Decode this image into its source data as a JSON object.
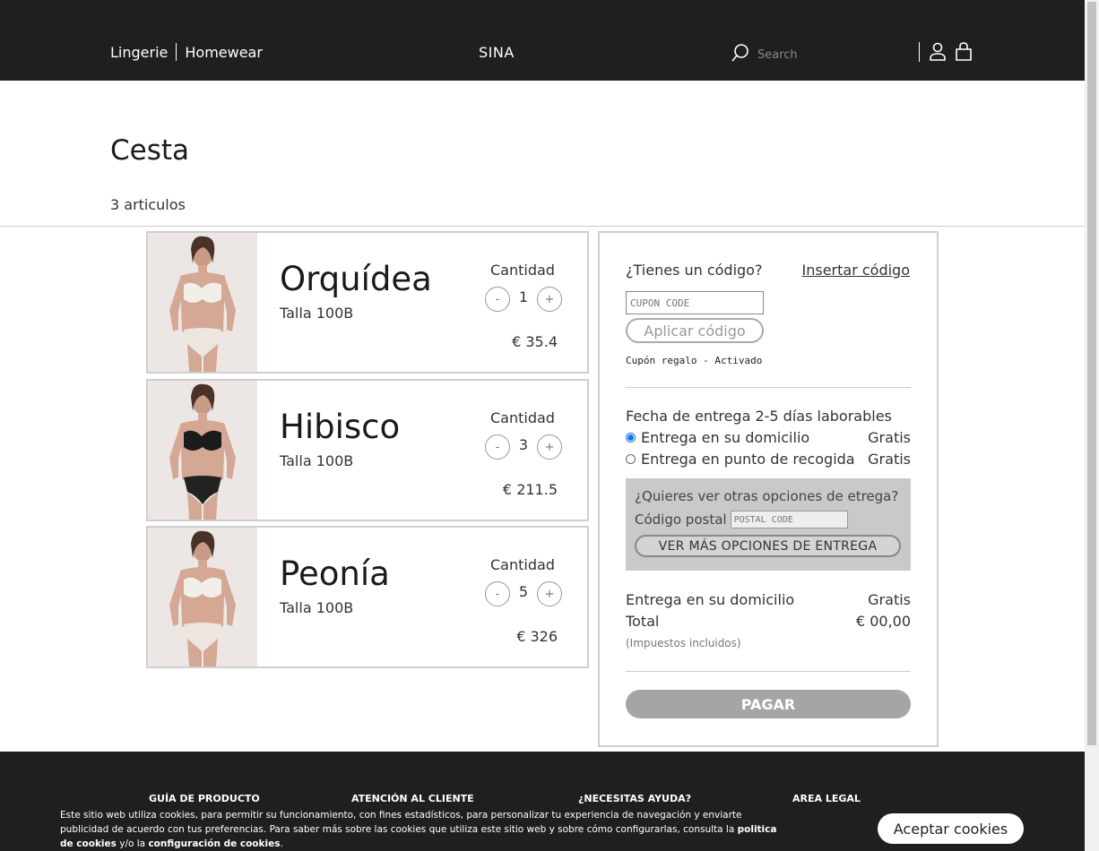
{
  "header": {
    "nav_lingerie": "Lingerie",
    "nav_homewear": "Homewear",
    "brand": "SINA",
    "search_placeholder": "Search"
  },
  "page": {
    "title": "Cesta",
    "item_count": "3 articulos"
  },
  "cart": {
    "items": [
      {
        "name": "Orquídea",
        "size": "Talla 100B",
        "qty_label": "Cantidad",
        "qty": "1",
        "price": "€ 35.4",
        "minus": "-",
        "plus": "+",
        "bra_color": "#f2efe9",
        "brief_color": "#ece6de"
      },
      {
        "name": "Hibisco",
        "size": "Talla 100B",
        "qty_label": "Cantidad",
        "qty": "3",
        "price": "€ 211.5",
        "minus": "-",
        "plus": "+",
        "bra_color": "#1b1b1b",
        "brief_color": "#222222"
      },
      {
        "name": "Peonía",
        "size": "Talla 100B",
        "qty_label": "Cantidad",
        "qty": "5",
        "price": "€ 326",
        "minus": "-",
        "plus": "+",
        "bra_color": "#f2efe9",
        "brief_color": "#ece6de"
      }
    ]
  },
  "summary": {
    "coupon_question": "¿Tienes un código?",
    "coupon_link": "Insertar código",
    "coupon_placeholder": "CUPON CODE",
    "apply_label": "Aplicar código",
    "gift_status": "Cupón regalo - Activado",
    "delivery_date": "Fecha de entrega 2-5 días laborables",
    "option_home": "Entrega en su domicilio",
    "option_home_price": "Gratis",
    "option_pickup": "Entrega en punto de recogida",
    "option_pickup_price": "Gratis",
    "more_options_question": "¿Quieres ver otras opciones de etrega?",
    "postal_label": "Código postal",
    "postal_placeholder": "POSTAL CODE",
    "more_options_button": "VER MÁS OPCIONES DE ENTREGA",
    "shipping_label": "Entrega en su domicilio",
    "shipping_value": "Gratis",
    "total_label": "Total",
    "total_value": "€ 00,00",
    "tax_note": "(Impuestos incluidos)",
    "pay_button": "PAGAR"
  },
  "footer": {
    "col1": "GUÍA DE PRODUCTO",
    "col2": "ATENCIÓN AL CLIENTE",
    "col3": "¿NECESITAS AYUDA?",
    "col4": "AREA LEGAL"
  },
  "cookies": {
    "text_1": "Este sitio web utiliza cookies, para permitir su funcionamiento, con fines estadísticos, para personalizar tu experiencia de navegación y enviarte publicidad de acuerdo con tus preferencias. Para saber más sobre las cookies que utiliza este sitio web y sobre cómo configurarlas, consulta la ",
    "policy_link": "politica de cookies",
    "text_2": " y/o la ",
    "config_link": "configuración de cookies",
    "text_3": ".",
    "accept_button": "Aceptar cookies"
  }
}
